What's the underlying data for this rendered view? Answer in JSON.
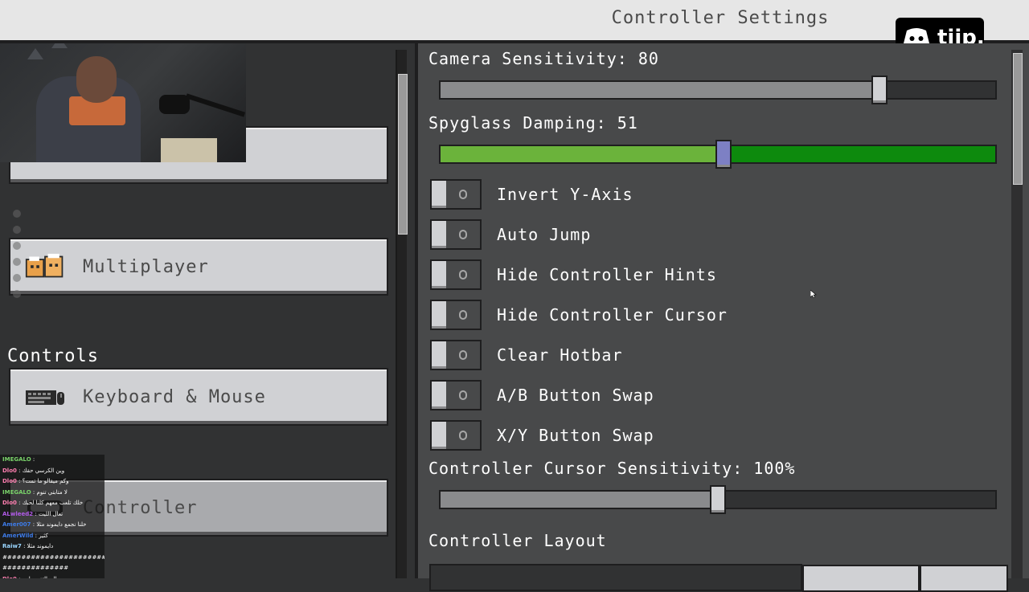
{
  "window": {
    "title": "Controller Settings"
  },
  "brand": {
    "text": "tiip.",
    "icon": "discord-icon"
  },
  "left_nav": {
    "sections": [
      {
        "header": "Controls"
      }
    ],
    "items": [
      {
        "label": "",
        "icon": "gamepad-icon"
      },
      {
        "label": "Multiplayer",
        "icon": "multiplayer-icon"
      },
      {
        "label": "Keyboard & Mouse",
        "icon": "keyboard-icon"
      },
      {
        "label": "Controller",
        "icon": "controller-icon",
        "selected": true
      }
    ]
  },
  "settings": {
    "camera_sensitivity": {
      "label": "Camera Sensitivity: 80",
      "value": 80,
      "max": 100
    },
    "spyglass_damping": {
      "label": "Spyglass Damping: 51",
      "value": 51,
      "max": 100
    },
    "toggles": [
      {
        "label": "Invert Y-Axis",
        "on": false
      },
      {
        "label": "Auto Jump",
        "on": false
      },
      {
        "label": "Hide Controller Hints",
        "on": false
      },
      {
        "label": "Hide Controller Cursor",
        "on": false
      },
      {
        "label": "Clear Hotbar",
        "on": false
      },
      {
        "label": "A/B Button Swap",
        "on": false
      },
      {
        "label": "X/Y Button Swap",
        "on": false
      }
    ],
    "cursor_sensitivity": {
      "label": "Controller Cursor Sensitivity: 100%",
      "value": 100,
      "max": 200
    },
    "layout_header": "Controller Layout"
  },
  "chat": [
    {
      "user": "IMEGALO",
      "color": "#7ad36a",
      "text": ""
    },
    {
      "user": "Dlo0",
      "color": "#ff7fb0",
      "text": "وين الكرسي حقك"
    },
    {
      "user": "Dlo0",
      "color": "#ff7fb0",
      "text": "وكم ميقالو ما تمت؟"
    },
    {
      "user": "IMEGALO",
      "color": "#7ad36a",
      "text": "لا متابتي تنوم"
    },
    {
      "user": "Dlo0",
      "color": "#ff7fb0",
      "text": "خلك تلعب معهم كلنا لحبك"
    },
    {
      "user": "ALwleed2",
      "color": "#b15ae8",
      "text": "تعال الليت"
    },
    {
      "user": "Amer007",
      "color": "#3d7be8",
      "text": "خلنا نجمع دايموند مثلا"
    },
    {
      "user": "AmerWild",
      "color": "#3d7be8",
      "text": "كثير"
    },
    {
      "user": "Raiw7",
      "color": "#9ad6ff",
      "text": "دايموند مثلا"
    },
    {
      "user": "",
      "color": "#ffffff",
      "text": "#######################"
    },
    {
      "user": "",
      "color": "#ffffff",
      "text": "##############"
    },
    {
      "user": "Dlo0",
      "color": "#ff7fb0",
      "text": "وال يالتف يطبي"
    }
  ],
  "colors": {
    "spyglass_fill": "#6bb33b",
    "spyglass_track": "#0d8a0d",
    "camera_fill": "#8a8b8d",
    "cursor_fill": "#8a8b8d",
    "spyglass_handle": "#7d80c4"
  }
}
